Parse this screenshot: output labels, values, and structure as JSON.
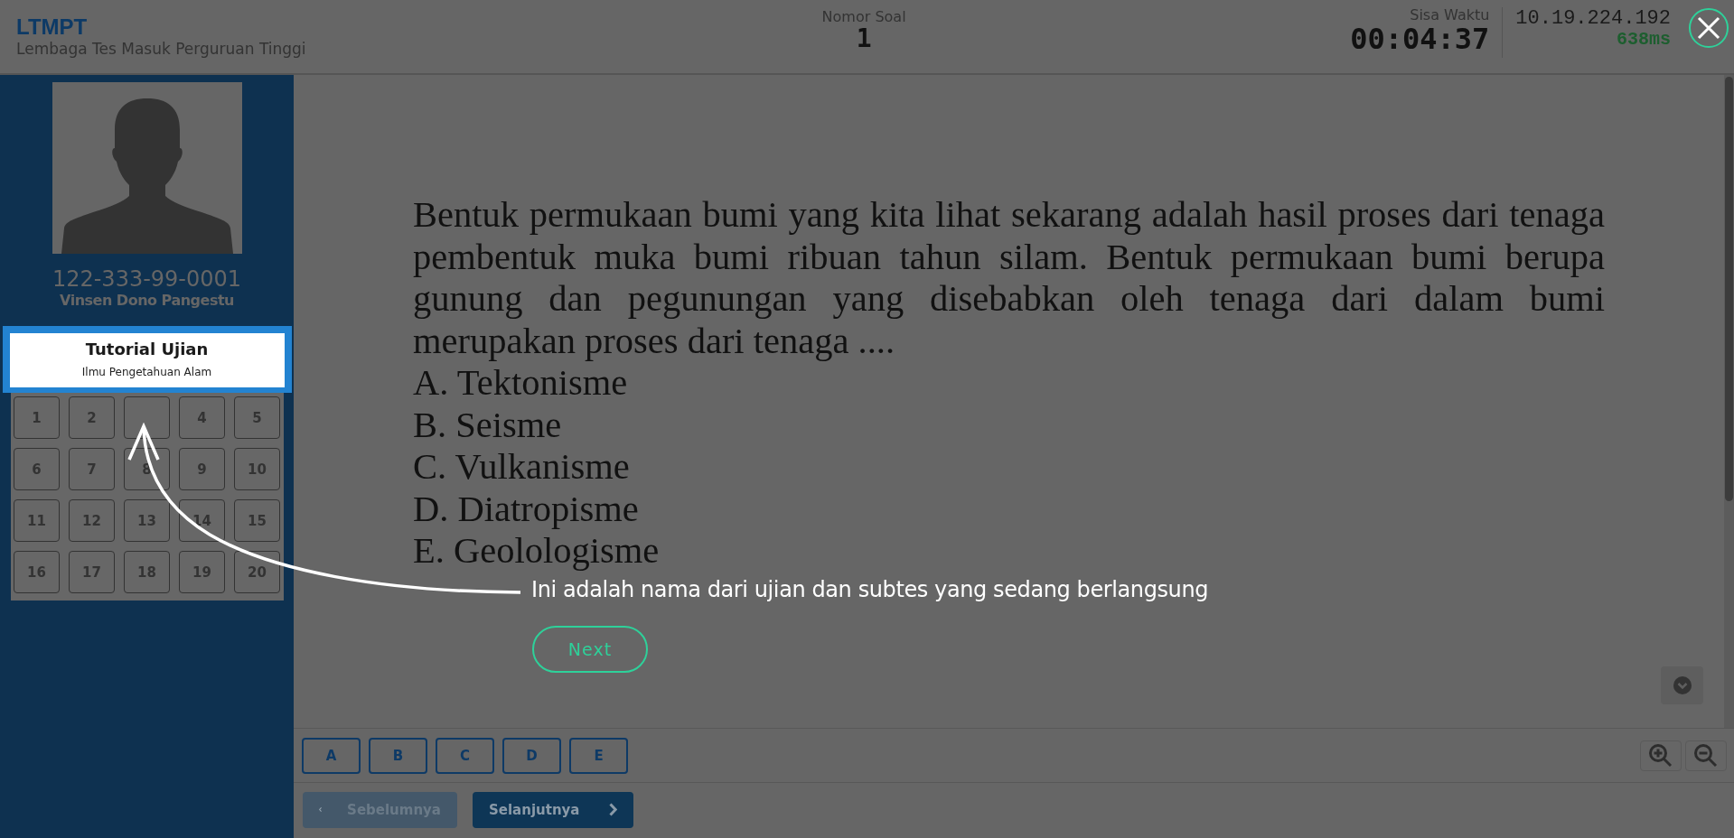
{
  "header": {
    "logo": "LTMPT",
    "subtitle": "Lembaga Tes Masuk Perguruan Tinggi",
    "question_number": {
      "label": "Nomor Soal",
      "value": "1"
    },
    "timer": {
      "label": "Sisa Waktu",
      "value": "00:04:37"
    },
    "server": {
      "ip": "10.19.224.192",
      "latency": "638ms"
    }
  },
  "sidebar": {
    "participant": {
      "id": "122-333-99-0001",
      "name": "Vinsen Dono Pangestu"
    },
    "exam": {
      "title": "Tutorial Ujian",
      "subtest": "Ilmu Pengetahuan Alam",
      "highlighted": true
    },
    "questions": [
      {
        "kind": "number",
        "label": "1"
      },
      {
        "kind": "number",
        "label": "2"
      },
      {
        "kind": "blank"
      },
      {
        "kind": "number",
        "label": "4"
      },
      {
        "kind": "number",
        "label": "5"
      },
      {
        "kind": "number",
        "label": "6"
      },
      {
        "kind": "number",
        "label": "7"
      },
      {
        "kind": "number",
        "label": "8"
      },
      {
        "kind": "number",
        "label": "9"
      },
      {
        "kind": "number",
        "label": "10"
      },
      {
        "kind": "number",
        "label": "11"
      },
      {
        "kind": "number",
        "label": "12"
      },
      {
        "kind": "number",
        "label": "13"
      },
      {
        "kind": "number",
        "label": "14"
      },
      {
        "kind": "number",
        "label": "15"
      },
      {
        "kind": "number",
        "label": "16"
      },
      {
        "kind": "number",
        "label": "17"
      },
      {
        "kind": "number",
        "label": "18"
      },
      {
        "kind": "number",
        "label": "19"
      },
      {
        "kind": "number",
        "label": "20"
      }
    ]
  },
  "question": {
    "text": "Bentuk permukaan bumi yang kita lihat sekarang adalah hasil proses dari tenaga pembentuk muka bumi ribuan tahun silam. Bentuk permukaan bumi berupa gunung dan pegunungan yang disebabkan oleh tenaga dari dalam bumi merupakan proses dari tenaga ....",
    "options": [
      "A. Tektonisme",
      "B. Seisme",
      "C. Vulkanisme",
      "D. Diatropisme",
      "E. Geolologisme"
    ]
  },
  "answers": [
    {
      "label": "A",
      "selected": false
    },
    {
      "label": "B",
      "selected": false
    },
    {
      "label": "C",
      "selected": false
    },
    {
      "label": "D",
      "selected": false
    },
    {
      "label": "E",
      "selected": false
    }
  ],
  "nav": [
    {
      "label": "Sebelumnya",
      "kind": "prev",
      "disabled": true
    },
    {
      "label": "Selanjutnya",
      "kind": "next",
      "disabled": false
    }
  ],
  "tour": {
    "message": "Ini adalah nama dari ujian dan subtes yang sedang berlangsung",
    "button": "Next"
  }
}
